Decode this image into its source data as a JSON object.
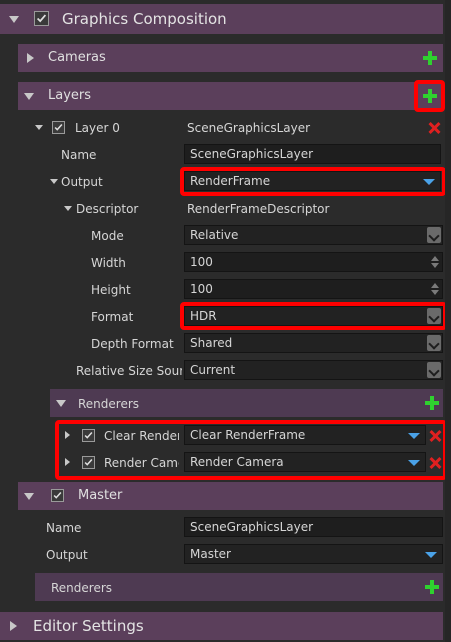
{
  "composition": {
    "title": "Graphics Composition"
  },
  "cameras": {
    "title": "Cameras"
  },
  "layers": {
    "title": "Layers",
    "layer0": {
      "title": "Layer 0",
      "type": "SceneGraphicsLayer",
      "name_label": "Name",
      "name_value": "SceneGraphicsLayer",
      "output_label": "Output",
      "output_value": "RenderFrame",
      "descriptor_label": "Descriptor",
      "descriptor_value": "RenderFrameDescriptor",
      "mode_label": "Mode",
      "mode_value": "Relative",
      "width_label": "Width",
      "width_value": "100",
      "height_label": "Height",
      "height_value": "100",
      "format_label": "Format",
      "format_value": "HDR",
      "depth_label": "Depth Format",
      "depth_value": "Shared",
      "relsize_label": "Relative Size Source",
      "relsize_value": "Current",
      "renderers_title": "Renderers",
      "renderers": [
        {
          "label": "Clear RenderFrame",
          "value": "Clear RenderFrame"
        },
        {
          "label": "Render Camera",
          "value": "Render Camera"
        }
      ]
    }
  },
  "master": {
    "title": "Master",
    "name_label": "Name",
    "name_value": "SceneGraphicsLayer",
    "output_label": "Output",
    "output_value": "Master",
    "renderers_title": "Renderers"
  },
  "editor_settings": {
    "title": "Editor Settings"
  },
  "colors": {
    "header": "#5b3f5b",
    "highlight": "#ff0000",
    "add": "#2fd12f",
    "remove": "#e02020",
    "dropdown": "#4aa2e8"
  }
}
